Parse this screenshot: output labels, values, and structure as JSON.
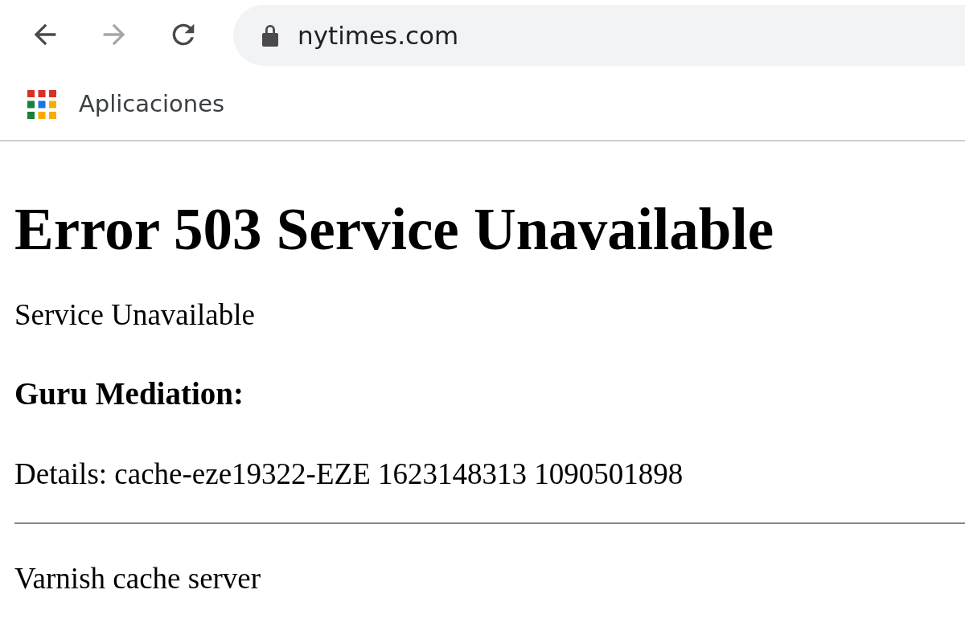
{
  "toolbar": {
    "buttons": [
      {
        "kind": "back",
        "disabled": false
      },
      {
        "kind": "forward",
        "disabled": true
      },
      {
        "kind": "reload",
        "disabled": false
      }
    ],
    "address": "nytimes.com"
  },
  "bookmarks": [
    {
      "label": "Aplicaciones"
    }
  ],
  "page": {
    "heading": "Error 503 Service Unavailable",
    "message": "Service Unavailable",
    "subheading": "Guru Mediation:",
    "details": "Details: cache-eze19322-EZE 1623148313 1090501898",
    "footer": "Varnish cache server"
  }
}
